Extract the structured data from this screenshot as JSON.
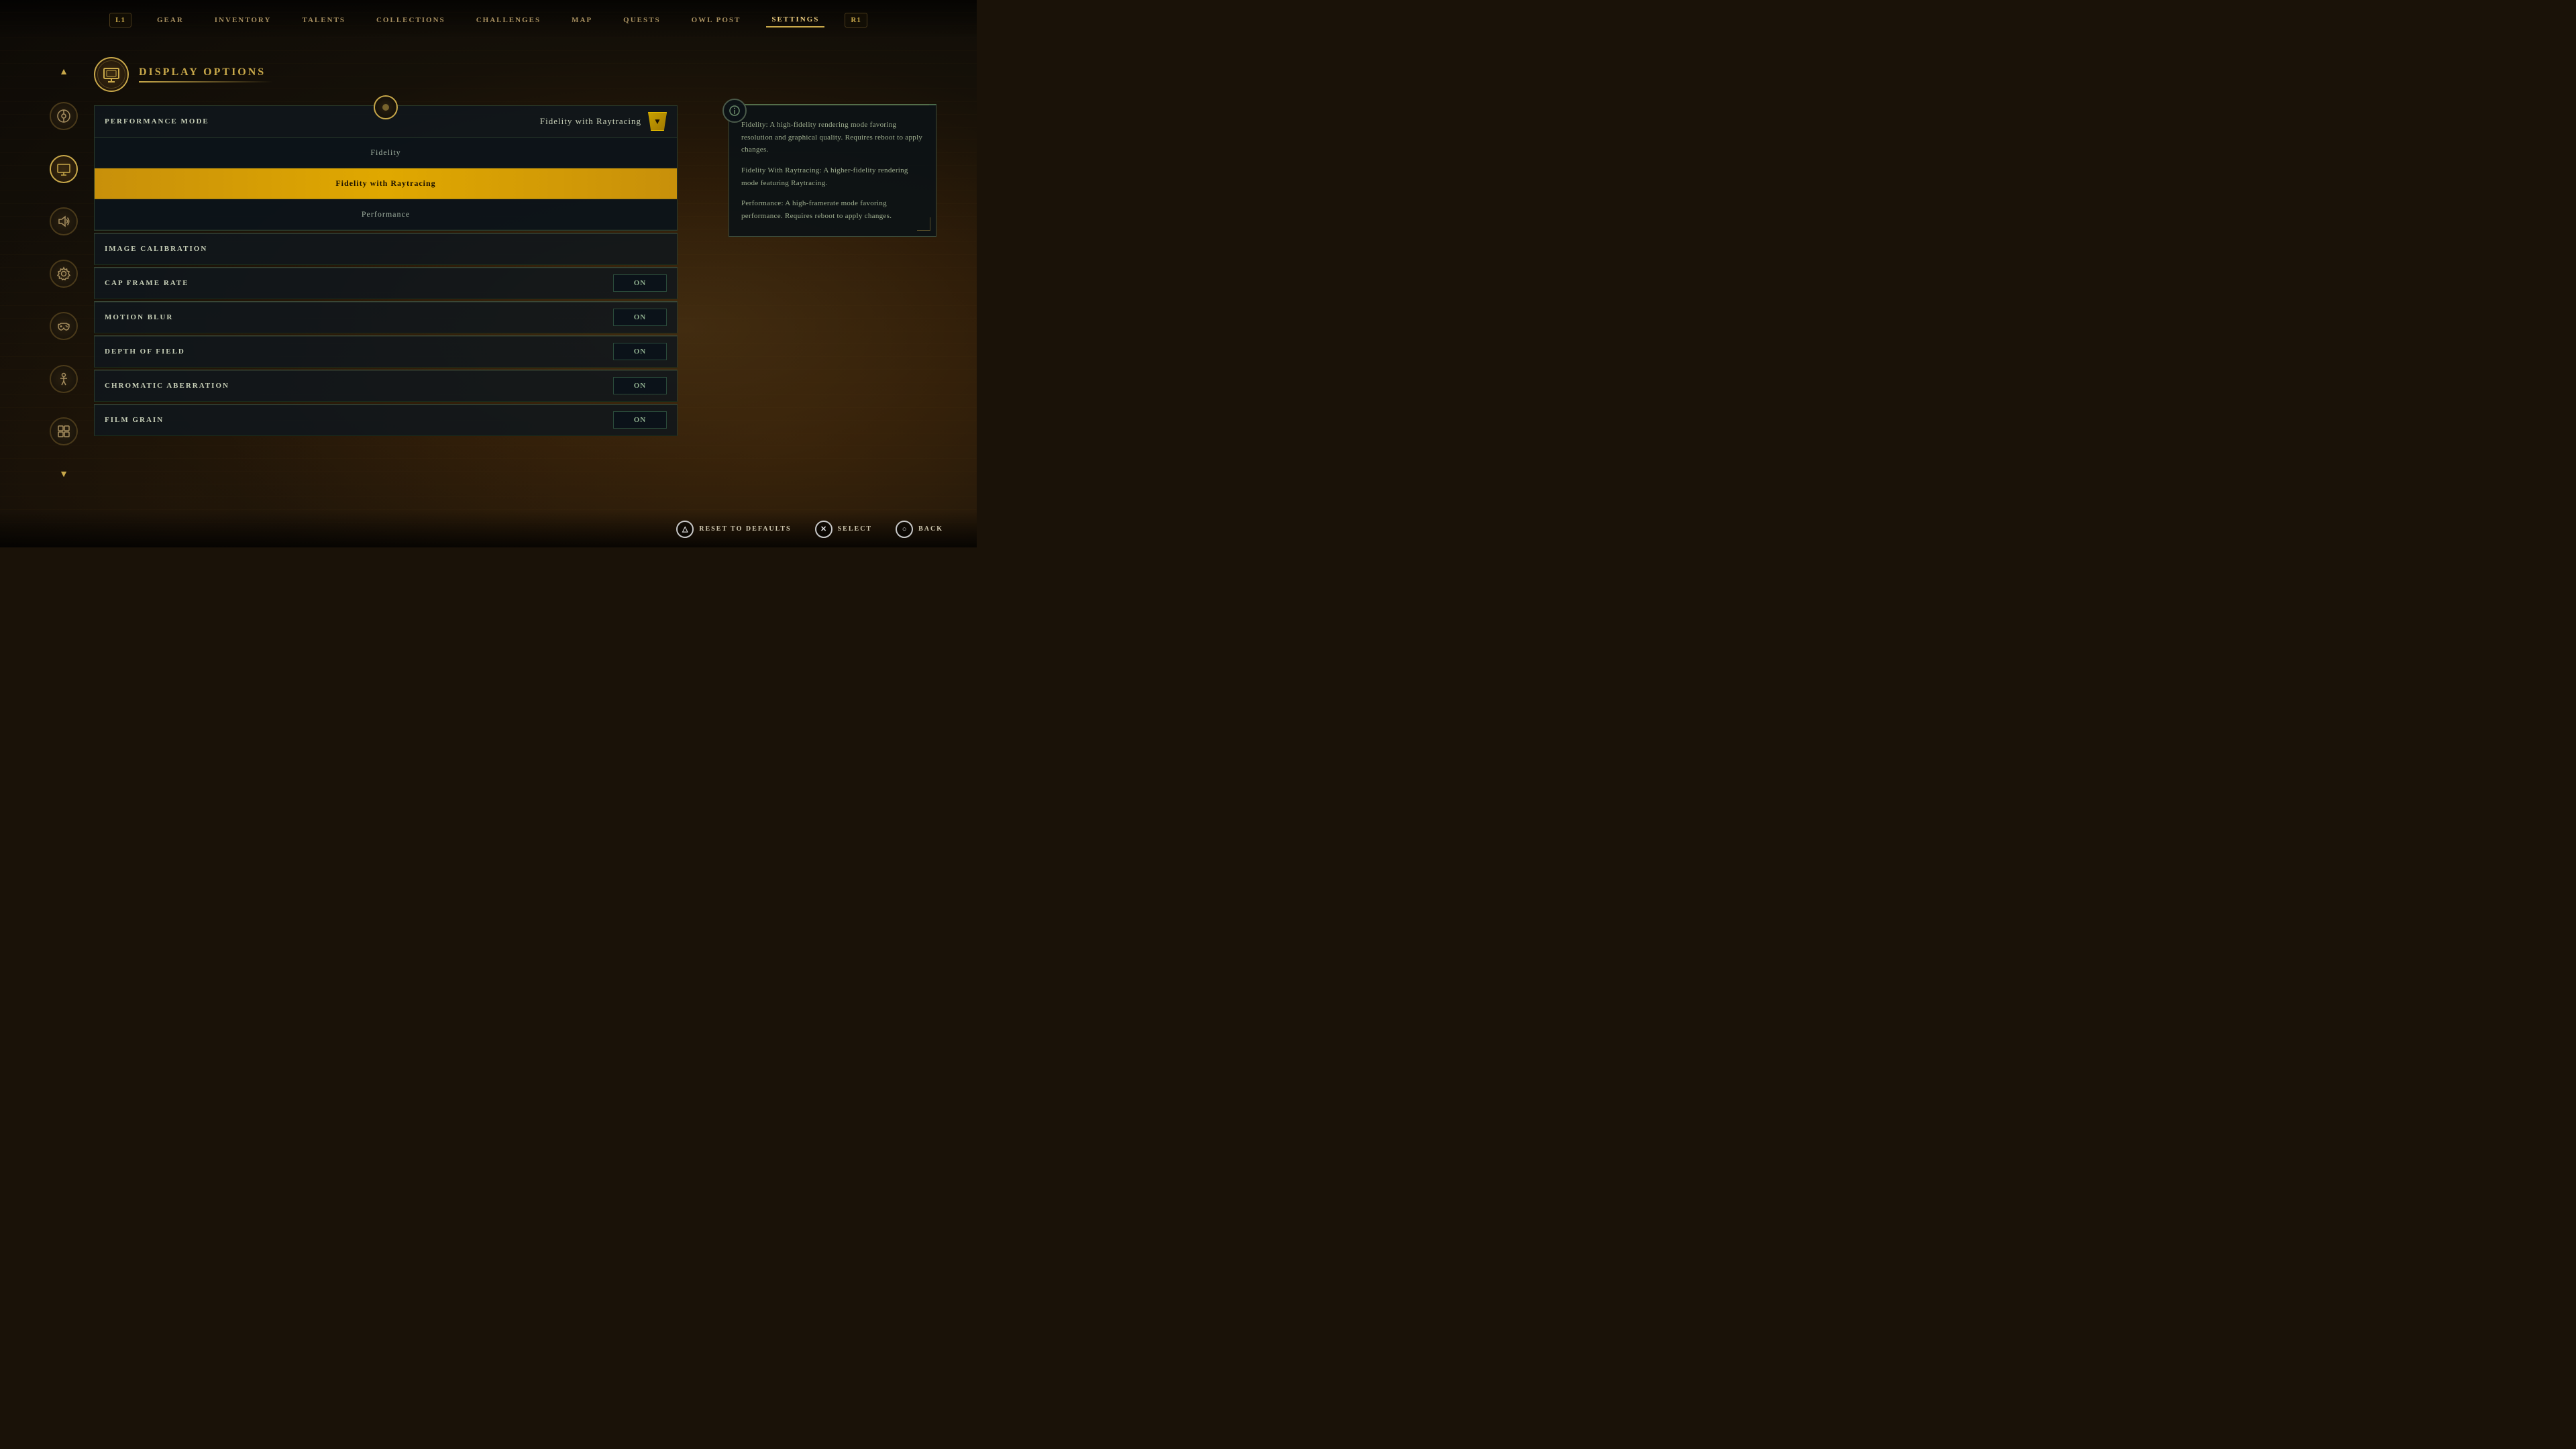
{
  "nav": {
    "left_btn": "L1",
    "right_btn": "R1",
    "items": [
      {
        "label": "GEAR",
        "active": false
      },
      {
        "label": "INVENTORY",
        "active": false
      },
      {
        "label": "TALENTS",
        "active": false
      },
      {
        "label": "COLLECTIONS",
        "active": false
      },
      {
        "label": "CHALLENGES",
        "active": false
      },
      {
        "label": "MAP",
        "active": false
      },
      {
        "label": "QUESTS",
        "active": false
      },
      {
        "label": "OWL POST",
        "active": false
      },
      {
        "label": "SETTINGS",
        "active": true
      }
    ]
  },
  "sidebar": {
    "icons": [
      {
        "name": "up-arrow",
        "symbol": "▲"
      },
      {
        "name": "disc-icon",
        "symbol": "◉"
      },
      {
        "name": "display-icon",
        "symbol": "▣"
      },
      {
        "name": "sound-icon",
        "symbol": "♪"
      },
      {
        "name": "gear-icon",
        "symbol": "⚙"
      },
      {
        "name": "controller-icon",
        "symbol": "⊡"
      },
      {
        "name": "accessibility-icon",
        "symbol": "♿"
      },
      {
        "name": "puzzle-icon",
        "symbol": "⊞"
      },
      {
        "name": "down-arrow",
        "symbol": "▼"
      }
    ]
  },
  "section": {
    "title": "DISPLAY OPTIONS",
    "icon_symbol": "▣"
  },
  "performance_mode": {
    "label": "PERFORMANCE MODE",
    "value": "Fidelity with Raytracing",
    "options": [
      {
        "label": "Fidelity",
        "selected": false
      },
      {
        "label": "Fidelity with Raytracing",
        "selected": true
      },
      {
        "label": "Performance",
        "selected": false
      }
    ]
  },
  "settings": [
    {
      "label": "IMAGE CALIBRATION",
      "value": "",
      "has_toggle": false
    },
    {
      "label": "CAP FRAME RATE",
      "value": "ON",
      "has_toggle": true
    },
    {
      "label": "MOTION BLUR",
      "value": "ON",
      "has_toggle": true
    },
    {
      "label": "DEPTH OF FIELD",
      "value": "ON",
      "has_toggle": true
    },
    {
      "label": "CHROMATIC ABERRATION",
      "value": "ON",
      "has_toggle": true
    },
    {
      "label": "FILM GRAIN",
      "value": "ON",
      "has_toggle": true
    }
  ],
  "info_panel": {
    "paragraphs": [
      "Fidelity: A high-fidelity rendering mode favoring resolution and graphical quality. Requires reboot to apply changes.",
      "Fidelity With Raytracing: A higher-fidelity rendering mode featuring Raytracing.",
      "Performance: A high-framerate mode favoring performance. Requires reboot to apply changes."
    ]
  },
  "bottom_actions": [
    {
      "button": "△",
      "label": "RESET TO DEFAULTS"
    },
    {
      "button": "✕",
      "label": "SELECT"
    },
    {
      "button": "○",
      "label": "BACK"
    }
  ]
}
